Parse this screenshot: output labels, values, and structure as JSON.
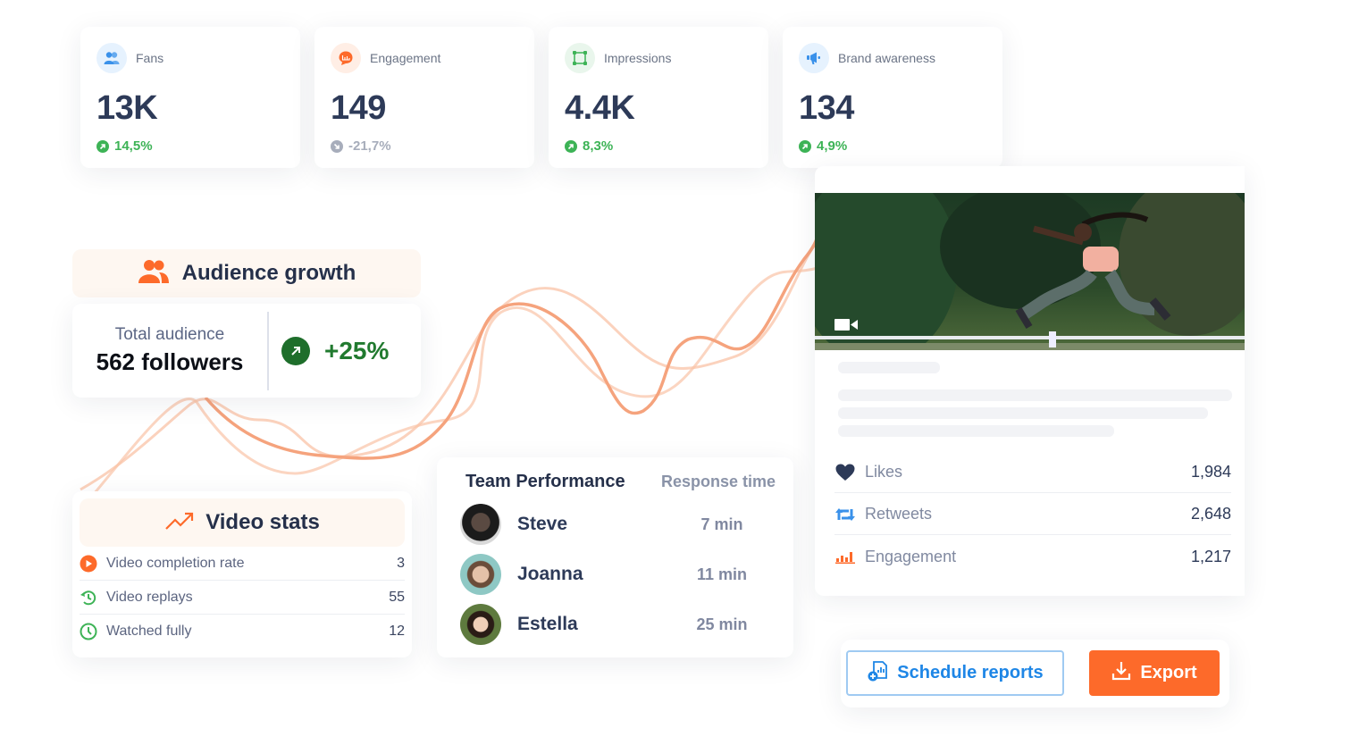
{
  "kpis": [
    {
      "label": "Fans",
      "value": "13K",
      "change": "14,5%",
      "trend": "up",
      "icon": "fans-icon"
    },
    {
      "label": "Engagement",
      "value": "149",
      "change": "-21,7%",
      "trend": "down",
      "icon": "engagement-chat-icon"
    },
    {
      "label": "Impressions",
      "value": "4.4K",
      "change": "8,3%",
      "trend": "up",
      "icon": "impressions-frame-icon"
    },
    {
      "label": "Brand awareness",
      "value": "134",
      "change": "4,9%",
      "trend": "up",
      "icon": "megaphone-icon"
    }
  ],
  "audience_growth": {
    "title": "Audience growth",
    "subtitle": "Total audience",
    "followers": "562 followers",
    "growth": "+25%"
  },
  "video_stats": {
    "title": "Video stats",
    "rows": [
      {
        "label": "Video completion rate",
        "value": "3",
        "icon": "play-circle-icon"
      },
      {
        "label": "Video replays",
        "value": "55",
        "icon": "replay-history-icon"
      },
      {
        "label": "Watched fully",
        "value": "12",
        "icon": "clock-icon"
      }
    ]
  },
  "team_performance": {
    "title": "Team Performance",
    "column": "Response time",
    "members": [
      {
        "name": "Steve",
        "time": "7 min"
      },
      {
        "name": "Joanna",
        "time": "11 min"
      },
      {
        "name": "Estella",
        "time": "25 min"
      }
    ]
  },
  "post": {
    "media_type": "video",
    "metrics": [
      {
        "label": "Likes",
        "value": "1,984",
        "icon": "heart-icon"
      },
      {
        "label": "Retweets",
        "value": "2,648",
        "icon": "retweet-icon"
      },
      {
        "label": "Engagement",
        "value": "1,217",
        "icon": "bar-chart-icon"
      }
    ]
  },
  "actions": {
    "schedule_label": "Schedule reports",
    "export_label": "Export"
  },
  "colors": {
    "accent_orange": "#fd6a2a",
    "accent_blue": "#1e86e6",
    "positive_green": "#3db356",
    "negative_gray": "#a7adbb",
    "heading_navy": "#2d3a58"
  }
}
